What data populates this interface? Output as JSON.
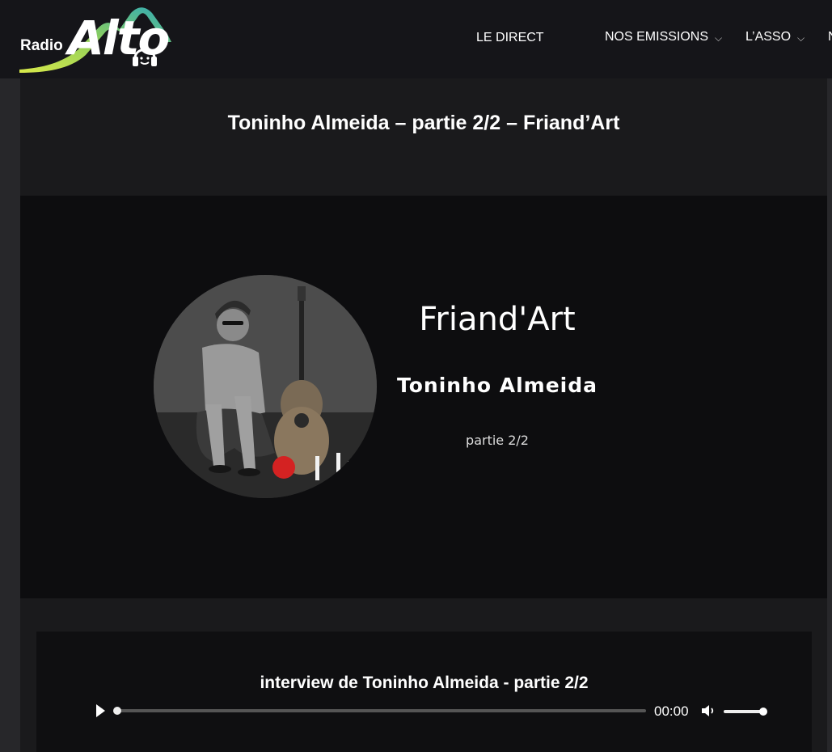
{
  "header": {
    "logo_small": "Radio",
    "logo_big": "Alto",
    "nav": [
      {
        "label": "LE DIRECT",
        "has_dropdown": false
      },
      {
        "label": "NOS EMISSIONS",
        "has_dropdown": true
      },
      {
        "label": "L’ASSO",
        "has_dropdown": true
      },
      {
        "label": "N",
        "has_dropdown": false
      }
    ]
  },
  "page": {
    "title": "Toninho Almeida – partie 2/2 – Friand’Art"
  },
  "feature_image": {
    "show": "Friand'Art",
    "artist": "Toninho Almeida",
    "part": "partie 2/2"
  },
  "audio": {
    "title": "interview de Toninho Almeida - partie 2/2",
    "time": "00:00",
    "progress": 0,
    "volume": 1.0,
    "play_icon": "play-icon",
    "mute_icon": "speaker-icon"
  },
  "colors": {
    "background": "#1a1a1c",
    "header": "#151519",
    "logo_gradient_start": "#c7e03a",
    "logo_gradient_end": "#3fb1b9",
    "record_dot": "#d42222"
  }
}
